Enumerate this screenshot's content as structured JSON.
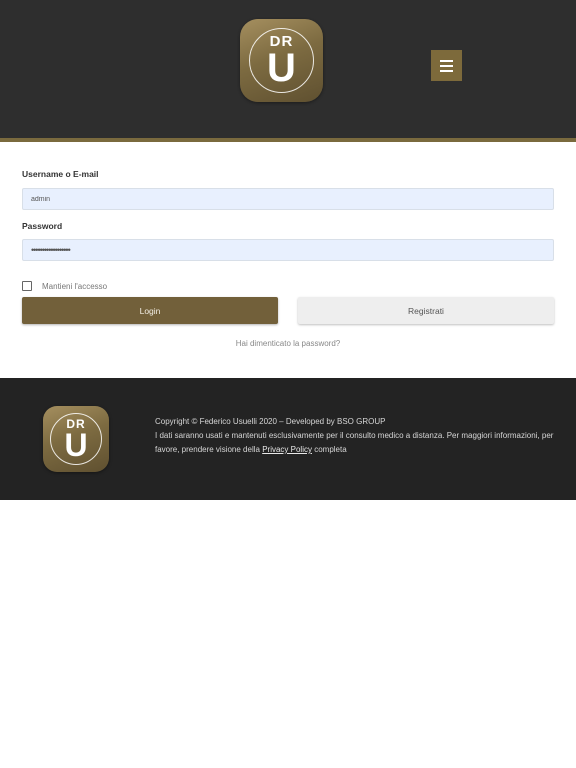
{
  "header": {
    "logo": {
      "text_top": "DR",
      "text_main": "U"
    },
    "menu_icon": "hamburger-menu-icon"
  },
  "form": {
    "username": {
      "label": "Username o E-mail",
      "value": "admin"
    },
    "password": {
      "label": "Password",
      "value": "••••••••••••••••••"
    },
    "remember_label": "Mantieni l'accesso",
    "remember_checked": false,
    "login_label": "Login",
    "register_label": "Registrati",
    "forgot_label": "Hai dimenticato la password?"
  },
  "footer": {
    "logo": {
      "text_top": "DR",
      "text_main": "U"
    },
    "copyright": "Copyright © Federico Usuelli 2020  – Developed by BSO GROUP",
    "info_prefix": "I dati saranno usati e mantenuti esclusivamente per il consulto medico a distanza. Per maggiori informazioni, per favore, prendere visione della ",
    "privacy_link": "Privacy Policy",
    "info_suffix": " completa"
  },
  "colors": {
    "header_bg": "#2e2e2e",
    "accent_gold": "#7a6a3e",
    "input_bg": "#e8f0fe",
    "footer_bg": "#232323"
  }
}
